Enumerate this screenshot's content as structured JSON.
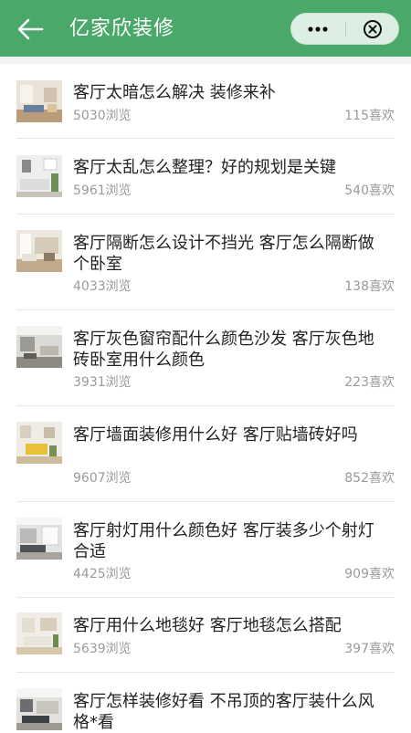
{
  "header": {
    "title": "亿家欣装修",
    "back_icon": "arrow-left-icon",
    "more_icon": "more-dots-icon",
    "close_icon": "close-circle-icon",
    "bg_color": "#4aa86a"
  },
  "articles": [
    {
      "title": "客厅太暗怎么解决 装修来补",
      "views": "5030浏览",
      "likes": "115喜欢"
    },
    {
      "title": "客厅太乱怎么整理？好的规划是关键",
      "views": "5961浏览",
      "likes": "540喜欢"
    },
    {
      "title": "客厅隔断怎么设计不挡光 客厅怎么隔断做个卧室",
      "views": "4033浏览",
      "likes": "138喜欢"
    },
    {
      "title": "客厅灰色窗帘配什么颜色沙发 客厅灰色地砖卧室用什么颜色",
      "views": "3931浏览",
      "likes": "223喜欢"
    },
    {
      "title": "客厅墙面装修用什么好 客厅贴墙砖好吗",
      "views": "9607浏览",
      "likes": "852喜欢"
    },
    {
      "title": "客厅射灯用什么颜色好 客厅装多少个射灯合适",
      "views": "4425浏览",
      "likes": "909喜欢"
    },
    {
      "title": "客厅用什么地毯好 客厅地毯怎么搭配",
      "views": "5639浏览",
      "likes": "397喜欢"
    },
    {
      "title": "客厅怎样装修好看 不吊顶的客厅装什么风格*看",
      "views": "",
      "likes": ""
    }
  ]
}
